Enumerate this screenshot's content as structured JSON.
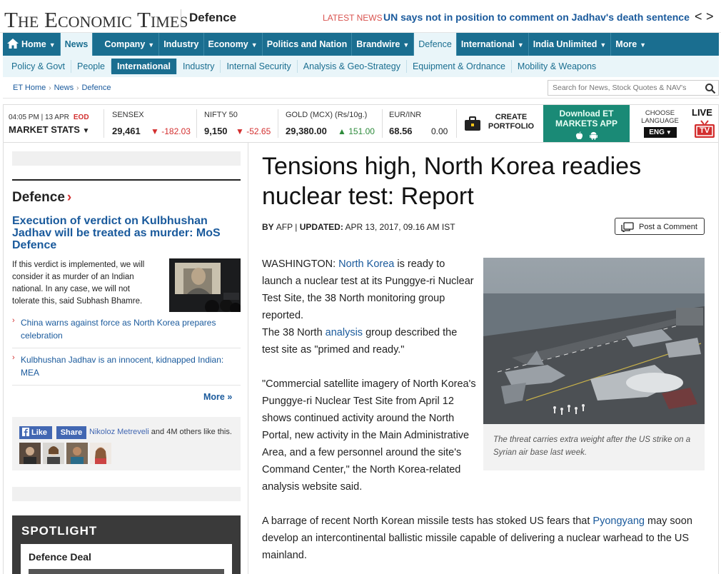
{
  "header": {
    "logo": "The Economic Times",
    "section": "Defence",
    "latest_label": "LATEST NEWS",
    "latest_headline": "UN says not in position to comment on Jadhav's death sentence",
    "prev": "<",
    "next": ">"
  },
  "main_nav": [
    {
      "label": "Home",
      "caret": "▼",
      "icon": "home-icon"
    },
    {
      "label": "News",
      "caret": ""
    },
    {
      "label": "Company",
      "caret": "▼"
    },
    {
      "label": "Industry",
      "caret": ""
    },
    {
      "label": "Economy",
      "caret": "▼"
    },
    {
      "label": "Politics and Nation",
      "caret": ""
    },
    {
      "label": "Brandwire",
      "caret": "▼"
    },
    {
      "label": "Defence",
      "caret": ""
    },
    {
      "label": "International",
      "caret": "▼"
    },
    {
      "label": "India Unlimited",
      "caret": "▼"
    },
    {
      "label": "More",
      "caret": "▼"
    }
  ],
  "sub_nav": [
    "Policy & Govt",
    "People",
    "International",
    "Industry",
    "Internal Security",
    "Analysis & Geo-Strategy",
    "Equipment & Ordnance",
    "Mobility & Weapons"
  ],
  "breadcrumb": [
    "ET Home",
    "News",
    "Defence"
  ],
  "breadcrumb_sep": "›",
  "search": {
    "placeholder": "Search for News, Stock Quotes & NAV's"
  },
  "market": {
    "time": "04:05 PM | 13 APR",
    "eod": "EOD",
    "stats_label": "MARKET STATS",
    "stats_caret": "▼",
    "items": [
      {
        "label": "SENSEX",
        "value": "29,461",
        "arrow": "▼",
        "change": "-182.03",
        "dir": "down"
      },
      {
        "label": "NIFTY 50",
        "value": "9,150",
        "arrow": "▼",
        "change": "-52.65",
        "dir": "down"
      },
      {
        "label": "GOLD (MCX) (Rs/10g.)",
        "value": "29,380.00",
        "arrow": "▲",
        "change": "151.00",
        "dir": "up"
      },
      {
        "label": "EUR/INR",
        "value": "68.56",
        "arrow": "",
        "change": "0.00",
        "dir": "flat"
      }
    ],
    "portfolio_line1": "CREATE",
    "portfolio_line2": "PORTFOLIO",
    "app_line1": "Download ET",
    "app_line2": "MARKETS APP",
    "lang_line1": "CHOOSE",
    "lang_line2": "LANGUAGE",
    "lang_value": "ENG",
    "live_label": "LIVE",
    "tv_label": "TV"
  },
  "sidebar": {
    "section_title": "Defence",
    "section_arrow": "›",
    "lead_headline": "Execution of verdict on Kulbhushan Jadhav will be treated as murder: MoS Defence",
    "lead_text": "If this verdict is implemented, we will consider it as murder of an Indian national. In any case, we will not tolerate this, said Subhash Bhamre.",
    "related": [
      "China warns against force as North Korea prepares celebration",
      "Kulbhushan Jadhav is an innocent, kidnapped Indian: MEA"
    ],
    "bullet": "›",
    "more": "More »",
    "fb_like": "Like",
    "fb_share": "Share",
    "fb_name": "Nikoloz Metreveli",
    "fb_others": " and 4M others like this.",
    "spotlight_title": "SPOTLIGHT",
    "spotlight_card": "Defence Deal"
  },
  "article": {
    "headline": "Tensions high, North Korea readies nuclear test: Report",
    "byline_prefix": "BY ",
    "byline_source": "AFP",
    "byline_sep": " | ",
    "byline_updated": "UPDATED:",
    "byline_date": " APR 13, 2017, 09.16 AM IST",
    "post_comment": "Post a Comment",
    "p1_a": "WASHINGTON: ",
    "p1_link": "North Korea",
    "p1_b": " is ready to launch a nuclear test at its Punggye-ri Nuclear Test Site, the 38 North monitoring group reported.",
    "p1_c": "The 38 North ",
    "p1_link2": "analysis",
    "p1_d": " group described the test site as \"primed and ready.\"",
    "p2": "\"Commercial satellite imagery of North Korea's Punggye-ri Nuclear Test Site from April 12 shows continued activity around the North Portal, new activity in the Main Administrative Area, and a few personnel around the site's Command Center,\" the North Korea-related analysis website said.",
    "p3_a": "A barrage of recent North Korean missile tests has stoked US fears that ",
    "p3_link": "Pyongyang",
    "p3_b": " may soon develop an intercontinental ballistic missile capable of delivering a nuclear warhead to the US mainland.",
    "caption": "The threat carries extra weight after the US strike on a Syrian air base last week."
  },
  "colors": {
    "nav": "#1a6e90",
    "link": "#1a5a9c",
    "down": "#d32f2f",
    "up": "#2e8b3c",
    "app": "#1a8a76"
  }
}
